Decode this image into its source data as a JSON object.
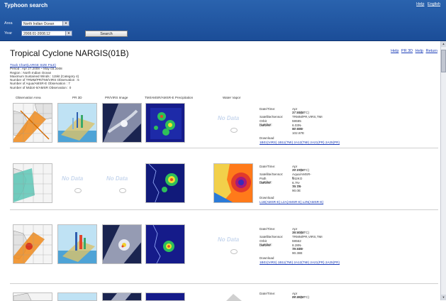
{
  "window": {
    "title": "Typhoon search",
    "top_links": [
      "Help",
      "English"
    ]
  },
  "search_form": {
    "area_label": "Area",
    "area_value": "North Indian Ocean",
    "year_label": "Year",
    "year_value": "2008.01-2008.12",
    "search_button": "Search"
  },
  "page": {
    "title": "Tropical Cyclone NARGIS(01B)",
    "links": [
      "Help",
      "PR 3D",
      "Help",
      "Return"
    ],
    "info": {
      "track_link": "Track Chart(LARGE SIZE FILE)",
      "lines": [
        "Period : Apr 27.2008 ~ May 03.2008",
        "Region : North Indian Ocean",
        "Maximum Sustained Winds : 115kt (Category 4)",
        "Number of TRMM/PR/TMI/VIRS Observation : 5",
        "Number of Aqua/AMSR-E Observation : 7",
        "Number of Midori-II/AMSR Observation : 0"
      ]
    },
    "column_headers": [
      "Observation Area",
      "PR 3D",
      "PR/VIRS Image",
      "TMI/AMSR/AMSR-E Precipitation",
      "Water Vapor"
    ],
    "no_data_text": "No Data"
  },
  "detail_labels": {
    "datetime": "Date/Time:",
    "sensor": "Satellite/Sensor:",
    "orbit": "Orbit Number:",
    "path": "Path Number:",
    "latlon": "Lat/Lon:",
    "download": "Download"
  },
  "rows": [
    {
      "datetime": [
        "Apr 27.2008",
        "17:51(UTC)"
      ],
      "sensor": "TRMM/PR,VIRS,TMI",
      "id_label": "orbit",
      "id_value": "59595",
      "latlon": [
        "6.03N-17.93N",
        "80.45E-102.87E"
      ],
      "download": "1B01(VIRS) 1B11(TMI) 2A12(TMI) 2A21(PR) 2A25(PR)"
    },
    {
      "datetime": [
        "Apr 27.2008",
        "20:17(UTC)"
      ],
      "sensor": "Aqua/AMSR-E",
      "id_label": "path",
      "id_value": "142KO",
      "latlon": [
        "6.7N-15.1N",
        "70.7E-90.0E"
      ],
      "download": "L1B(AMSR-E) L2A(AMSR-E) L2N(AMSR-E)"
    },
    {
      "datetime": [
        "Apr 28.2008",
        "15:50(UTC)"
      ],
      "sensor": "TRMM/PR,VIRS,TMI",
      "id_label": "orbit",
      "id_value": "59562",
      "latlon": [
        "8.28N-19.24N",
        "79.83E-90.38E"
      ],
      "download": "1B01(VIRS) 1B11(TMI) 2A12(TMI) 2A21(PR) 2A25(PR)"
    },
    {
      "datetime": [
        "Apr 29.2008",
        "07:45(UTC)"
      ]
    }
  ],
  "colors": {
    "header_blue": "#1f56a2",
    "link_blue": "#1a3cb8"
  }
}
